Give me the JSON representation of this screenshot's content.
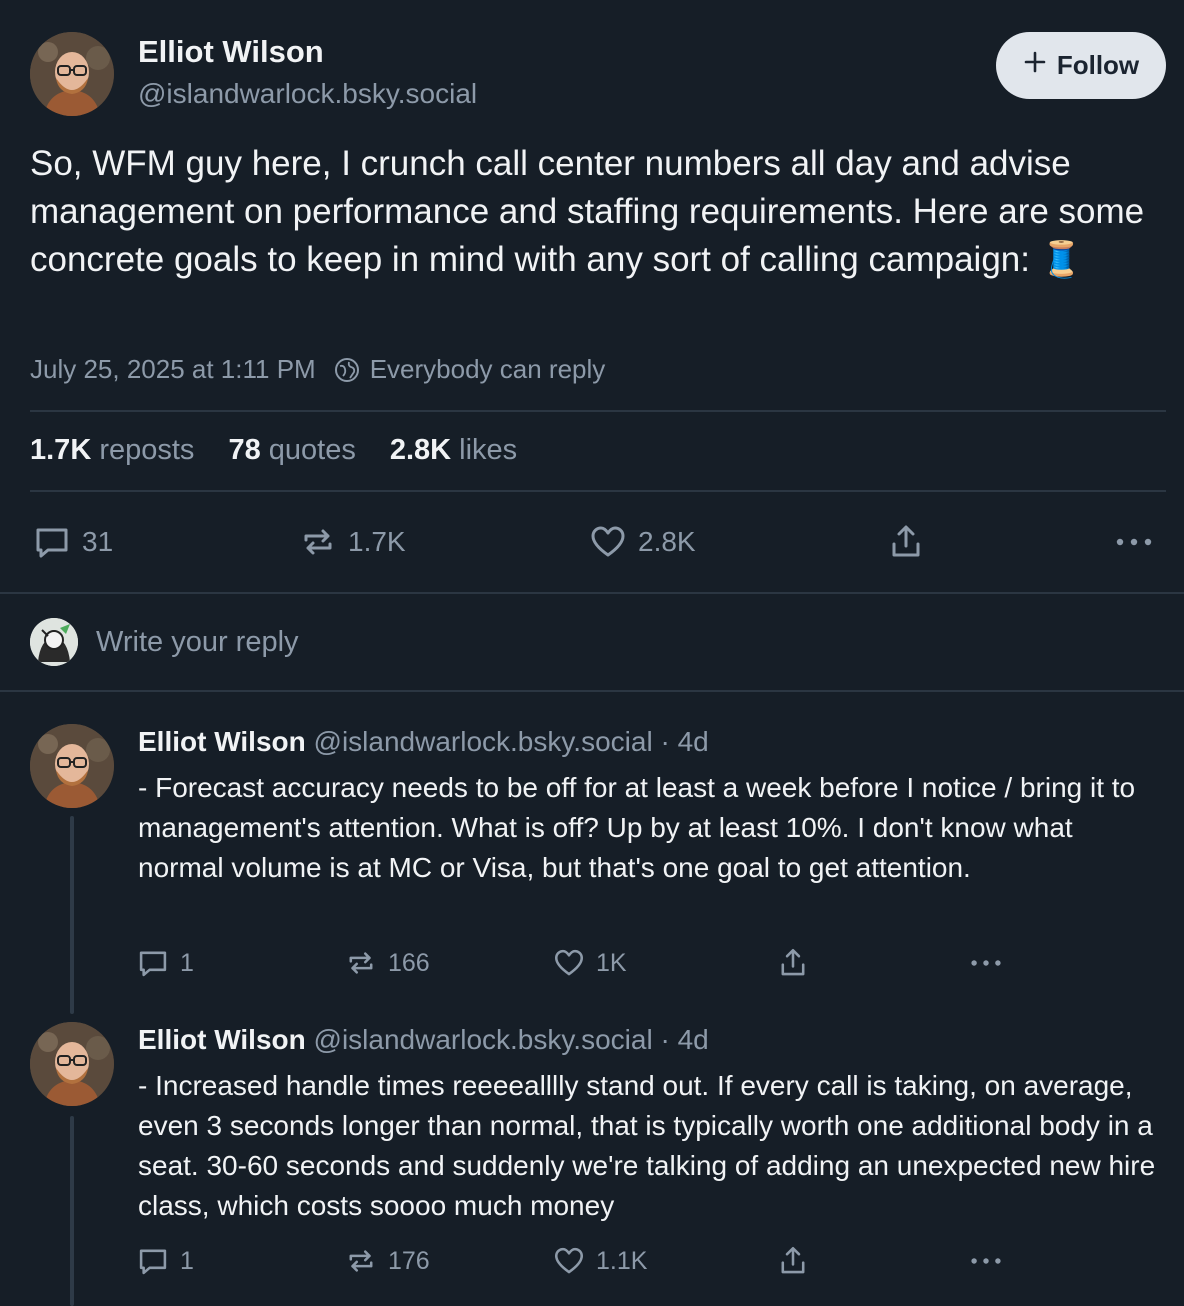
{
  "post": {
    "author_name": "Elliot Wilson",
    "author_handle": "@islandwarlock.bsky.social",
    "follow_label": "Follow",
    "text": "So, WFM guy here, I crunch call center numbers all day and advise management on performance and staffing requirements. Here are some concrete goals to keep in mind with any sort of calling campaign: 🧵",
    "timestamp": "July 25, 2025 at 1:11 PM",
    "reply_setting": "Everybody can reply",
    "stats": {
      "reposts_count": "1.7K",
      "reposts_label": "reposts",
      "quotes_count": "78",
      "quotes_label": "quotes",
      "likes_count": "2.8K",
      "likes_label": "likes"
    },
    "actions": {
      "replies": "31",
      "reposts": "1.7K",
      "likes": "2.8K"
    }
  },
  "reply_box": {
    "placeholder": "Write your reply"
  },
  "replies": [
    {
      "author_name": "Elliot Wilson",
      "author_handle": "@islandwarlock.bsky.social",
      "sep": "·",
      "age": "4d",
      "text": "- Forecast accuracy needs to be off for at least a week before I notice / bring it to management's attention. What is off? Up by at least 10%. I don't know what normal volume is at MC or Visa, but that's one goal to get attention.",
      "replies": "1",
      "reposts": "166",
      "likes": "1K"
    },
    {
      "author_name": "Elliot Wilson",
      "author_handle": "@islandwarlock.bsky.social",
      "sep": "·",
      "age": "4d",
      "text": "- Increased handle times reeeealllly stand out. If every call is taking, on average, even 3 seconds longer than normal, that is typically worth one additional body in a seat. 30-60 seconds and suddenly we're talking of adding an unexpected new hire class, which costs soooo much money",
      "replies": "1",
      "reposts": "176",
      "likes": "1.1K"
    }
  ],
  "colors": {
    "background": "#161e27",
    "text": "#f1f3f5",
    "muted": "#8d9aa9",
    "divider": "#2b3642",
    "follow_bg": "#e1e6ec"
  },
  "icons": [
    "plus-icon",
    "globe-icon",
    "comment-icon",
    "repost-icon",
    "heart-icon",
    "share-icon",
    "more-icon"
  ]
}
